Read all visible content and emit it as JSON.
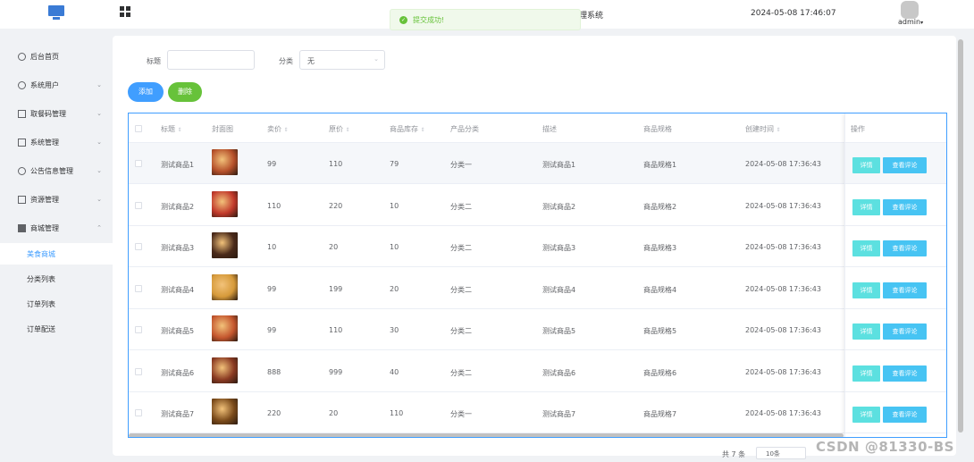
{
  "header": {
    "system_title_fragment": "理系统",
    "datetime": "2024-05-08 17:46:07",
    "username": "admin",
    "caret": "▾"
  },
  "toast": {
    "message": "提交成功!",
    "icon": "check-circle-icon",
    "color": "#67c23a"
  },
  "sidebar": {
    "menus": [
      {
        "label": "后台首页",
        "icon": "clock-icon",
        "expandable": false
      },
      {
        "label": "系统用户",
        "icon": "user-icon",
        "expandable": true,
        "chevron": "⌄"
      },
      {
        "label": "取餐码管理",
        "icon": "id-card-icon",
        "expandable": true,
        "chevron": "⌄"
      },
      {
        "label": "系统管理",
        "icon": "folder-icon",
        "expandable": true,
        "chevron": "⌄"
      },
      {
        "label": "公告信息管理",
        "icon": "sun-icon",
        "expandable": true,
        "chevron": "⌄"
      },
      {
        "label": "资源管理",
        "icon": "box-icon",
        "expandable": true,
        "chevron": "⌄"
      },
      {
        "label": "商城管理",
        "icon": "shop-icon",
        "expandable": true,
        "chevron": "⌃"
      }
    ],
    "sub_items": [
      {
        "label": "美食商城",
        "active": true
      },
      {
        "label": "分类列表",
        "active": false
      },
      {
        "label": "订单列表",
        "active": false
      },
      {
        "label": "订单配送",
        "active": false
      }
    ]
  },
  "filters": {
    "title_label": "标题",
    "title_value": "",
    "category_label": "分类",
    "category_value": "无",
    "arrow": "⌄"
  },
  "actions": {
    "add_label": "添加",
    "delete_label": "删除"
  },
  "table": {
    "columns": [
      "标题",
      "封面图",
      "卖价",
      "原价",
      "商品库存",
      "产品分类",
      "描述",
      "商品规格",
      "创建时间",
      "操作"
    ],
    "sort_glyph": "⇕",
    "rows": [
      {
        "title": "测试商品1",
        "price": "99",
        "original": "110",
        "stock": "79",
        "category": "分类一",
        "desc": "测试商品1",
        "spec": "商品规格1",
        "created": "2024-05-08 17:36:43",
        "thumb_color": "#b5502a"
      },
      {
        "title": "测试商品2",
        "price": "110",
        "original": "220",
        "stock": "10",
        "category": "分类二",
        "desc": "测试商品2",
        "spec": "商品规格2",
        "created": "2024-05-08 17:36:43",
        "thumb_color": "#c1392b"
      },
      {
        "title": "测试商品3",
        "price": "10",
        "original": "20",
        "stock": "10",
        "category": "分类二",
        "desc": "测试商品3",
        "spec": "商品规格3",
        "created": "2024-05-08 17:36:43",
        "thumb_color": "#4a2a1a"
      },
      {
        "title": "测试商品4",
        "price": "99",
        "original": "199",
        "stock": "20",
        "category": "分类二",
        "desc": "测试商品4",
        "spec": "商品规格4",
        "created": "2024-05-08 17:36:43",
        "thumb_color": "#d69a3a"
      },
      {
        "title": "测试商品5",
        "price": "99",
        "original": "110",
        "stock": "30",
        "category": "分类二",
        "desc": "测试商品5",
        "spec": "商品规格5",
        "created": "2024-05-08 17:36:43",
        "thumb_color": "#c4562e"
      },
      {
        "title": "测试商品6",
        "price": "888",
        "original": "999",
        "stock": "40",
        "category": "分类二",
        "desc": "测试商品6",
        "spec": "商品规格6",
        "created": "2024-05-08 17:36:43",
        "thumb_color": "#8a3a22"
      },
      {
        "title": "测试商品7",
        "price": "220",
        "original": "20",
        "stock": "110",
        "category": "分类一",
        "desc": "测试商品7",
        "spec": "商品规格7",
        "created": "2024-05-08 17:36:43",
        "thumb_color": "#7a4a1a"
      }
    ],
    "detail_label": "详情",
    "review_label": "查看评论"
  },
  "pager": {
    "label": "共 7 条",
    "size_value": "10条"
  },
  "watermark": "CSDN @81330-BS",
  "colors": {
    "primary": "#409eff",
    "success": "#67c23a",
    "detail": "#5ce0e0",
    "review": "#47c4f3"
  }
}
